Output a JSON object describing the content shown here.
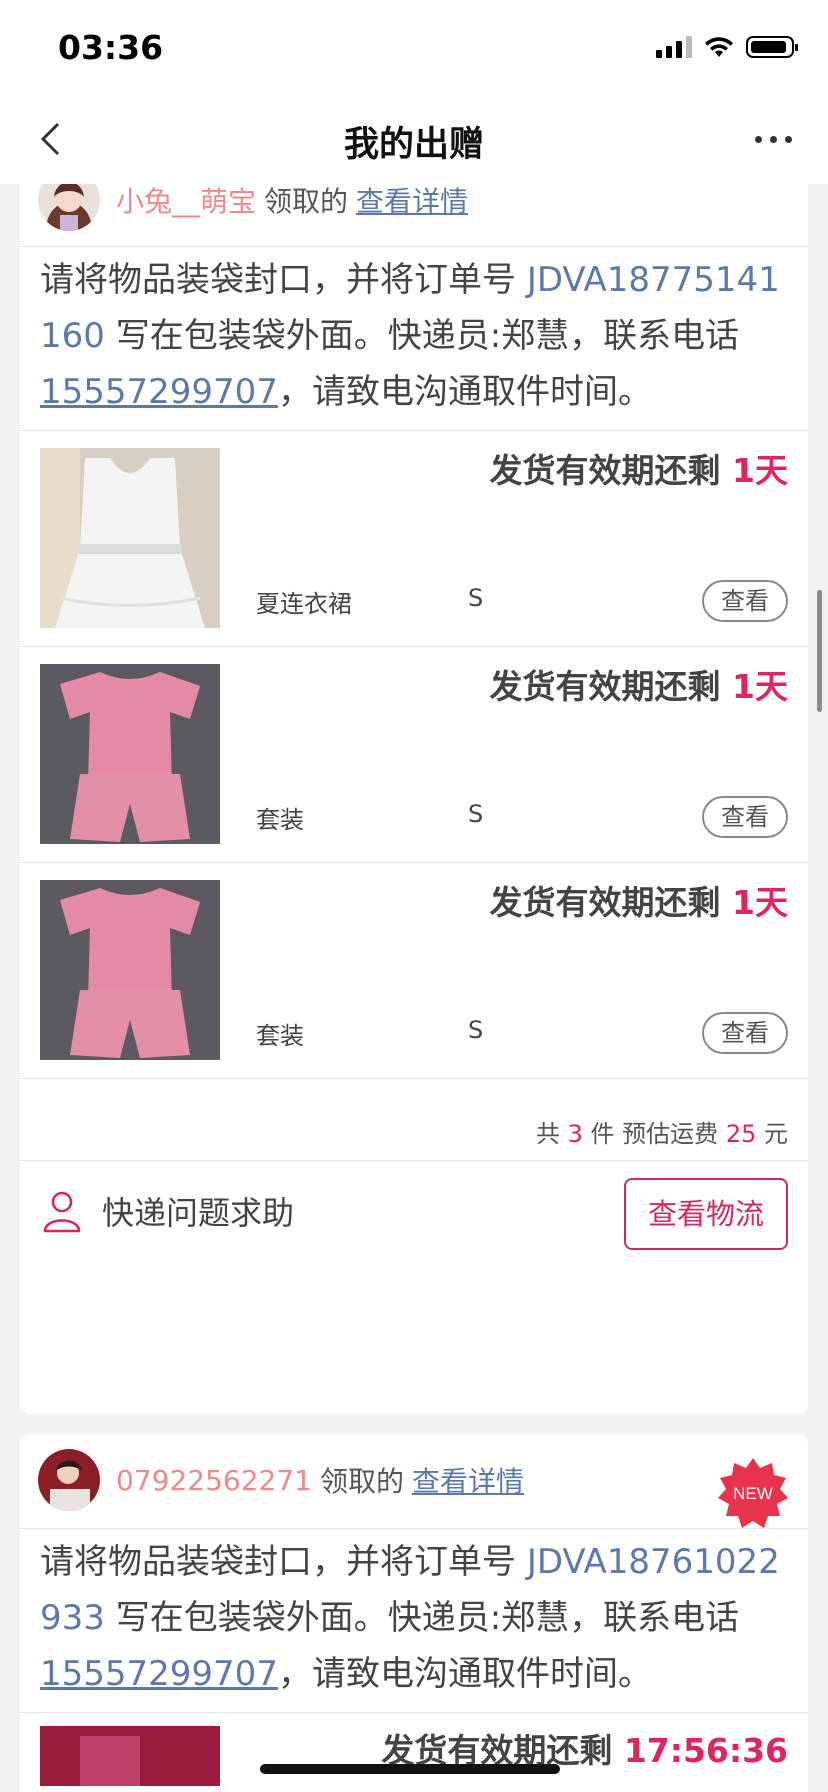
{
  "status_bar": {
    "time": "03:36"
  },
  "nav": {
    "title": "我的出赠"
  },
  "orders": [
    {
      "receiver_name": "小兔__萌宝",
      "received_label": "领取的",
      "detail_link": "查看详情",
      "instruction": {
        "part1": "请将物品装袋封口，并将订单号 ",
        "order_no": "JDVA18775141160",
        "part2": " 写在包装袋外面。快递员:郑慧，联系电话",
        "phone": "15557299707",
        "part3": "，请致电沟通取件时间。"
      },
      "items": [
        {
          "deadline_label": "发货有效期还剩 ",
          "deadline_value": "1天",
          "name": "夏连衣裙",
          "size": "S",
          "view_label": "查看"
        },
        {
          "deadline_label": "发货有效期还剩 ",
          "deadline_value": "1天",
          "name": "套装",
          "size": "S",
          "view_label": "查看"
        },
        {
          "deadline_label": "发货有效期还剩 ",
          "deadline_value": "1天",
          "name": "套装",
          "size": "S",
          "view_label": "查看"
        }
      ],
      "summary": {
        "prefix": "共 ",
        "count": "3",
        "mid": " 件 预估运费 ",
        "fee": "25",
        "suffix": " 元"
      },
      "help_label": "快递问题求助",
      "logistics_label": "查看物流"
    },
    {
      "receiver_name": "07922562271",
      "received_label": "领取的",
      "detail_link": "查看详情",
      "badge": "NEW",
      "instruction": {
        "part1": "请将物品装袋封口，并将订单号 ",
        "order_no": "JDVA18761022933",
        "part2": " 写在包装袋外面。快递员:郑慧，联系电话",
        "phone": "15557299707",
        "part3": "，请致电沟通取件时间。"
      },
      "items": [
        {
          "deadline_label": "发货有效期还剩 ",
          "deadline_value": "17:56:36"
        }
      ]
    }
  ],
  "colors": {
    "accent": "#e0245e",
    "link": "#5d79a8",
    "name": "#ef8a8a"
  }
}
